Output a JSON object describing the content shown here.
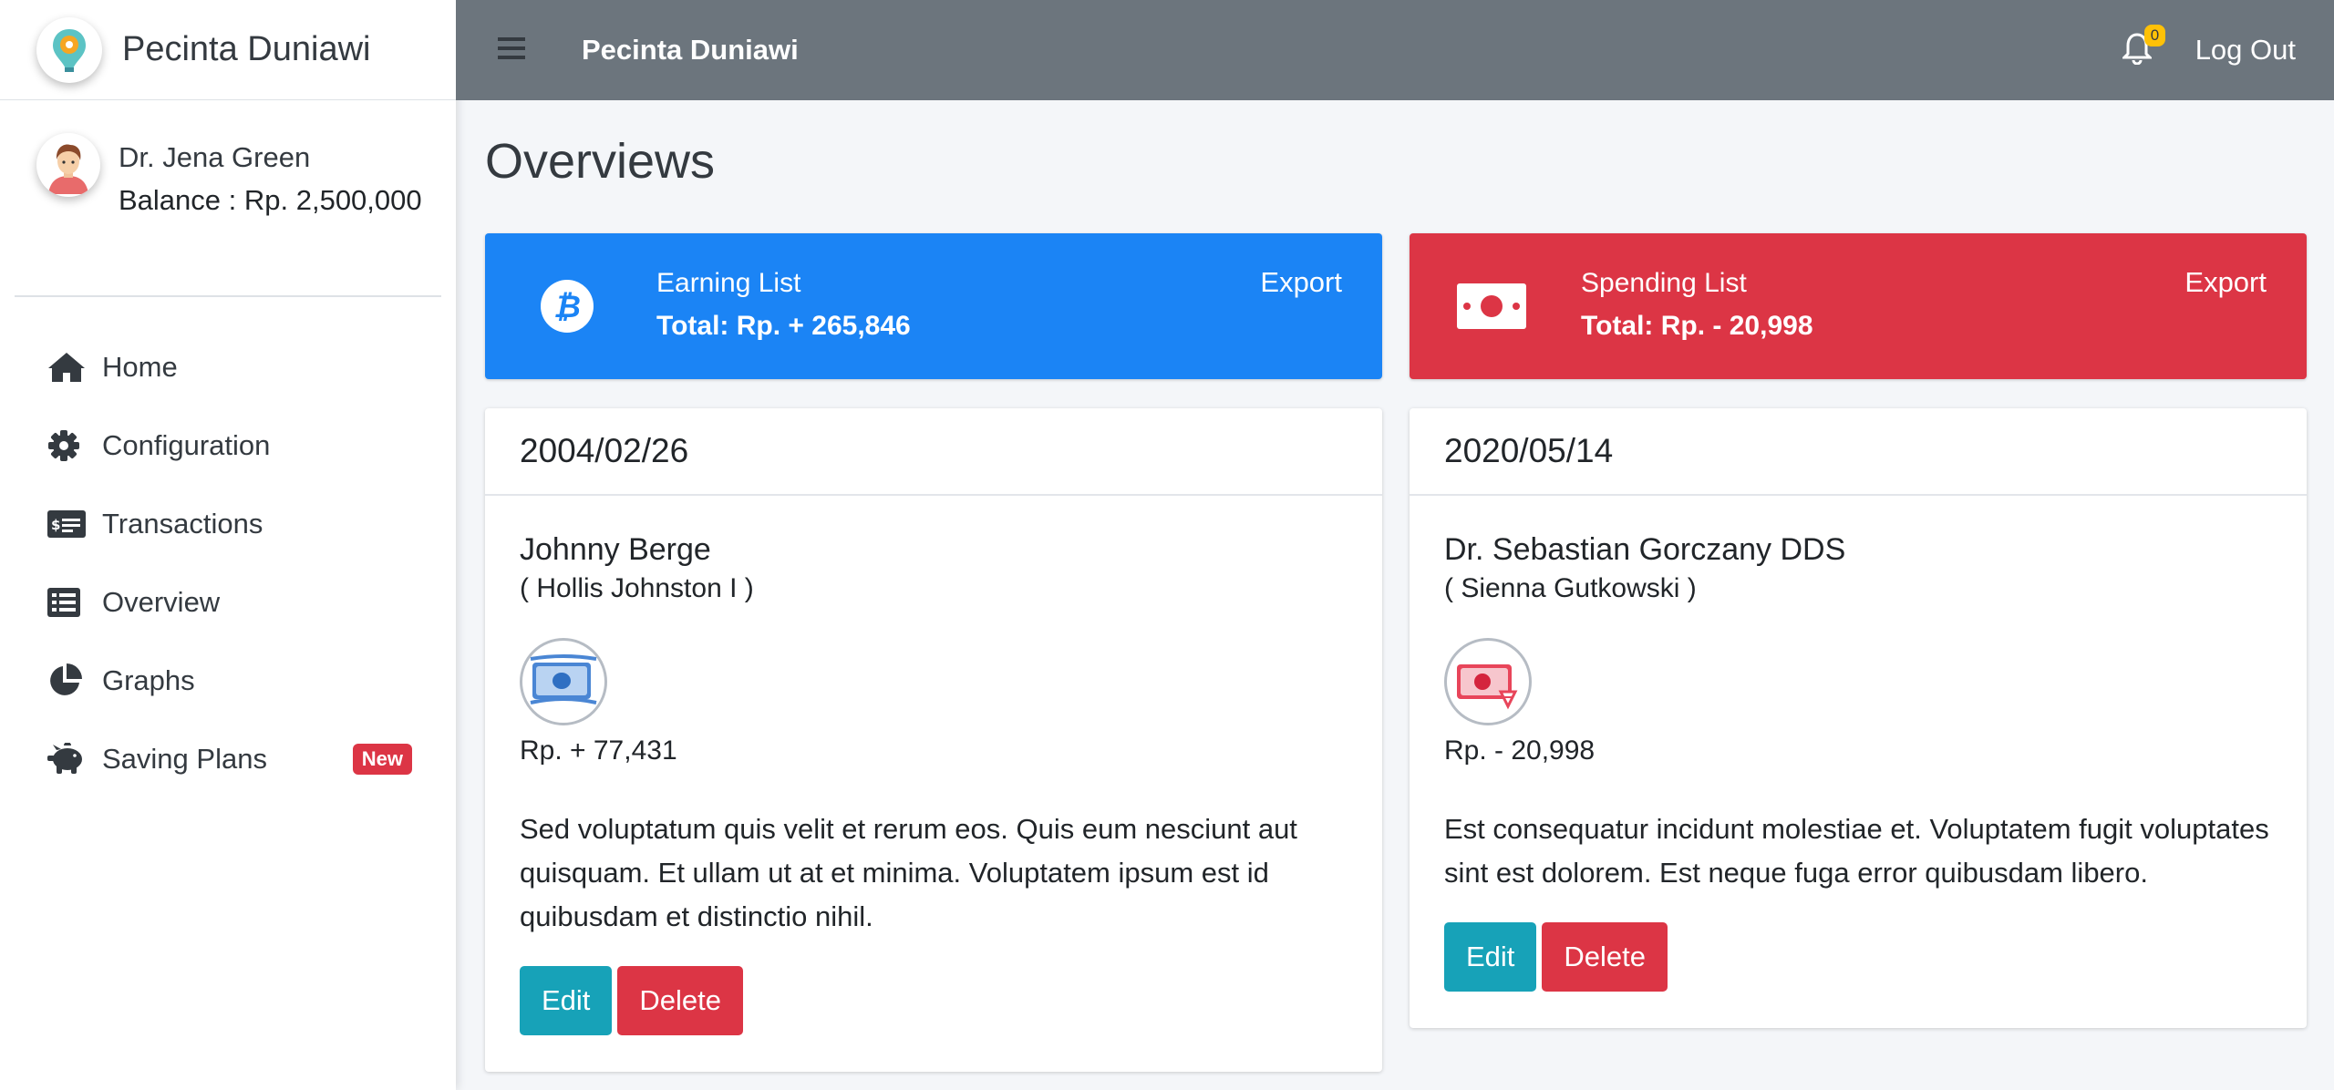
{
  "brand": {
    "name": "Pecinta Duniawi"
  },
  "user": {
    "name": "Dr. Jena Green",
    "balance": "Balance : Rp. 2,500,000"
  },
  "sidebar": {
    "items": [
      {
        "label": "Home",
        "icon": "home-icon"
      },
      {
        "label": "Configuration",
        "icon": "gear-icon"
      },
      {
        "label": "Transactions",
        "icon": "money-check-icon"
      },
      {
        "label": "Overview",
        "icon": "list-icon"
      },
      {
        "label": "Graphs",
        "icon": "pie-chart-icon"
      },
      {
        "label": "Saving Plans",
        "icon": "piggy-bank-icon",
        "badge": "New"
      }
    ]
  },
  "topbar": {
    "title": "Pecinta Duniawi",
    "notification_count": "0",
    "logout_label": "Log Out"
  },
  "page": {
    "title": "Overviews"
  },
  "summary": {
    "earning": {
      "title": "Earning List",
      "total": "Total: Rp. + 265,846",
      "export_label": "Export",
      "color": "#1b84f5"
    },
    "spending": {
      "title": "Spending List",
      "total": "Total: Rp. - 20,998",
      "export_label": "Export",
      "color": "#dc3545"
    }
  },
  "cards": [
    {
      "date": "2004/02/26",
      "name": "Johnny Berge",
      "sub": "( Hollis Johnston I )",
      "amount": "Rp. + 77,431",
      "description": "Sed voluptatum quis velit et rerum eos. Quis eum nesciunt aut quisquam. Et ullam ut at et minima. Voluptatem ipsum est id quibusdam et distinctio nihil.",
      "edit_label": "Edit",
      "delete_label": "Delete"
    },
    {
      "date": "2020/05/14",
      "name": "Dr. Sebastian Gorczany DDS",
      "sub": "( Sienna Gutkowski )",
      "amount": "Rp. - 20,998",
      "description": "Est consequatur incidunt molestiae et. Voluptatem fugit voluptates sint est dolorem. Est neque fuga error quibusdam libero.",
      "edit_label": "Edit",
      "delete_label": "Delete"
    }
  ]
}
